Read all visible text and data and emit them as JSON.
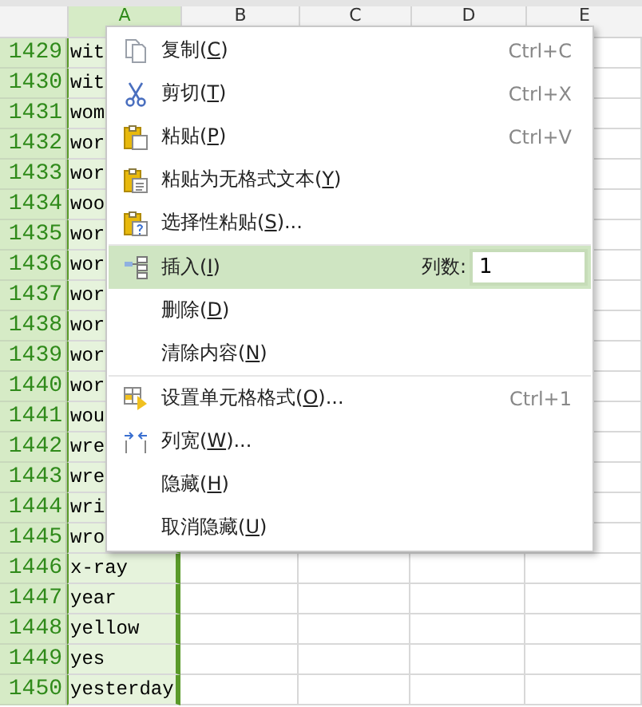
{
  "columns": [
    {
      "label": "A",
      "selected": true
    },
    {
      "label": "B",
      "selected": false
    },
    {
      "label": "C",
      "selected": false
    },
    {
      "label": "D",
      "selected": false
    },
    {
      "label": "E",
      "selected": false
    }
  ],
  "rows": [
    {
      "number": "1429",
      "cell": "wit",
      "selected": true
    },
    {
      "number": "1430",
      "cell": "wit",
      "selected": true
    },
    {
      "number": "1431",
      "cell": "wom",
      "selected": true
    },
    {
      "number": "1432",
      "cell": "wor",
      "selected": true
    },
    {
      "number": "1433",
      "cell": "wor",
      "selected": true
    },
    {
      "number": "1434",
      "cell": "woo",
      "selected": true
    },
    {
      "number": "1435",
      "cell": "wor",
      "selected": true
    },
    {
      "number": "1436",
      "cell": "wor",
      "selected": true
    },
    {
      "number": "1437",
      "cell": "wor",
      "selected": true
    },
    {
      "number": "1438",
      "cell": "wor",
      "selected": true
    },
    {
      "number": "1439",
      "cell": "wor",
      "selected": true
    },
    {
      "number": "1440",
      "cell": "wor",
      "selected": true
    },
    {
      "number": "1441",
      "cell": "wou",
      "selected": true
    },
    {
      "number": "1442",
      "cell": "wre",
      "selected": true
    },
    {
      "number": "1443",
      "cell": "wre",
      "selected": true
    },
    {
      "number": "1444",
      "cell": "wri",
      "selected": true
    },
    {
      "number": "1445",
      "cell": "wro",
      "selected": true
    },
    {
      "number": "1446",
      "cell": "x-ray",
      "selected": true
    },
    {
      "number": "1447",
      "cell": "year",
      "selected": true
    },
    {
      "number": "1448",
      "cell": "yellow",
      "selected": true
    },
    {
      "number": "1449",
      "cell": "yes",
      "selected": true
    },
    {
      "number": "1450",
      "cell": "yesterday",
      "selected": true
    }
  ],
  "context_menu": {
    "groups": [
      [
        {
          "label": "复制(",
          "mnemonic": "C",
          "label_end": ")",
          "shortcut": "Ctrl+C",
          "selected": false
        },
        {
          "label": "剪切(",
          "mnemonic": "T",
          "label_end": ")",
          "shortcut": "Ctrl+X",
          "selected": false
        },
        {
          "label": "粘贴(",
          "mnemonic": "P",
          "label_end": ")",
          "shortcut": "Ctrl+V",
          "selected": false
        },
        {
          "label": "粘贴为无格式文本(",
          "mnemonic": "Y",
          "label_end": ")",
          "selected": false
        },
        {
          "label": "选择性粘贴(",
          "mnemonic": "S",
          "label_end": ")...",
          "selected": false
        }
      ],
      [
        {
          "label": "插入(",
          "mnemonic": "I",
          "label_end": ")",
          "selected": true,
          "field_label": "列数:",
          "field_value": "1"
        },
        {
          "label": "删除(",
          "mnemonic": "D",
          "label_end": ")",
          "selected": false
        },
        {
          "label": "清除内容(",
          "mnemonic": "N",
          "label_end": ")",
          "selected": false
        }
      ],
      [
        {
          "label": "设置单元格格式(",
          "mnemonic": "O",
          "label_end": ")...",
          "shortcut": "Ctrl+1",
          "selected": false
        },
        {
          "label": "列宽(",
          "mnemonic": "W",
          "label_end": ")...",
          "selected": false
        },
        {
          "label": "隐藏(",
          "mnemonic": "H",
          "label_end": ")",
          "selected": false
        },
        {
          "label": "取消隐藏(",
          "mnemonic": "U",
          "label_end": ")",
          "selected": false
        }
      ]
    ]
  }
}
